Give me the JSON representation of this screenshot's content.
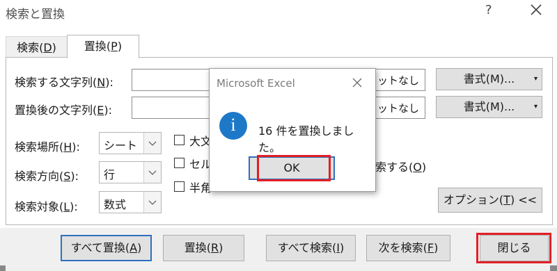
{
  "window": {
    "title": "検索と置換",
    "help": "?"
  },
  "tabs": [
    {
      "label": "検索(",
      "mnemonic": "D",
      "suffix": ")"
    },
    {
      "label": "置換(",
      "mnemonic": "P",
      "suffix": ")"
    }
  ],
  "fields": {
    "find_label": "検索する文字列(",
    "find_mn": "N",
    "find_suffix": "):",
    "replace_label": "置換後の文字列(",
    "replace_mn": "E",
    "replace_suffix": "):",
    "format_preview_1": "ットなし",
    "format_preview_2": "ットなし",
    "format_btn_1": "書式(M)...",
    "format_btn_2": "書式(M)..."
  },
  "options": {
    "within_label": "検索場所(",
    "within_mn": "H",
    "within_suffix": "):",
    "within_value": "シート",
    "search_label": "検索方向(",
    "search_mn": "S",
    "search_suffix": "):",
    "search_value": "行",
    "lookin_label": "検索対象(",
    "lookin_mn": "L",
    "lookin_suffix": "):",
    "lookin_value": "数式",
    "check_case": "大文",
    "check_cell": "セル",
    "check_cell_tail": "索する(",
    "check_cell_mn": "O",
    "check_cell_suffix": ")",
    "check_width": "半角",
    "options_btn": "オプション(",
    "options_btn_mn": "T",
    "options_btn_suffix": ") <<"
  },
  "buttons": {
    "replace_all": "すべて置換(",
    "replace_all_mn": "A",
    "replace": "置換(",
    "replace_mn": "R",
    "find_all": "すべて検索(",
    "find_all_mn": "I",
    "find_next": "次を検索(",
    "find_next_mn": "F",
    "close": "閉じる",
    "paren": ")"
  },
  "message_box": {
    "title": "Microsoft Excel",
    "text": "16 件を置換しました。",
    "ok": "OK",
    "icon": "info-icon"
  },
  "colors": {
    "highlight": "#e21f26",
    "info": "#1e78c8"
  }
}
